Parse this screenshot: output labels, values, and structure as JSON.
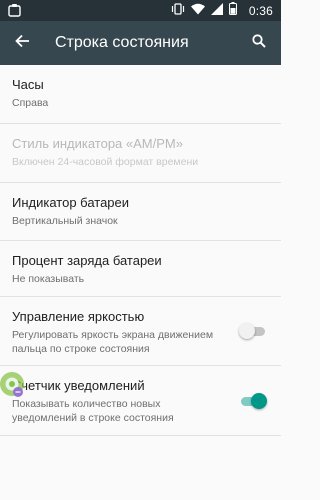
{
  "status_bar": {
    "time": "0:36",
    "icons": [
      "notification-icon",
      "vibrate-icon",
      "wifi-icon",
      "signal-icon",
      "battery-icon"
    ]
  },
  "toolbar": {
    "title": "Строка состояния",
    "back_icon": "arrow-back-icon",
    "search_icon": "search-icon"
  },
  "items": [
    {
      "title": "Часы",
      "summary": "Справа",
      "enabled": true
    },
    {
      "title": "Стиль индикатора «AM/PM»",
      "summary": "Включен 24-часовой формат времени",
      "enabled": false
    },
    {
      "title": "Индикатор батареи",
      "summary": "Вертикальный значок",
      "enabled": true
    },
    {
      "title": "Процент заряда батареи",
      "summary": "Не показывать",
      "enabled": true
    },
    {
      "title": "Управление яркостью",
      "summary": "Регулировать яркость экрана движением пальца по строке состояния",
      "enabled": true,
      "toggle": false
    },
    {
      "title": "Счетчик уведомлений",
      "summary": "Показывать количество новых уведомлений в строке состояния",
      "enabled": true,
      "toggle": true
    }
  ],
  "colors": {
    "status_bar": "#263238",
    "toolbar": "#37474f",
    "background": "#fafafa",
    "accent": "#009688"
  }
}
